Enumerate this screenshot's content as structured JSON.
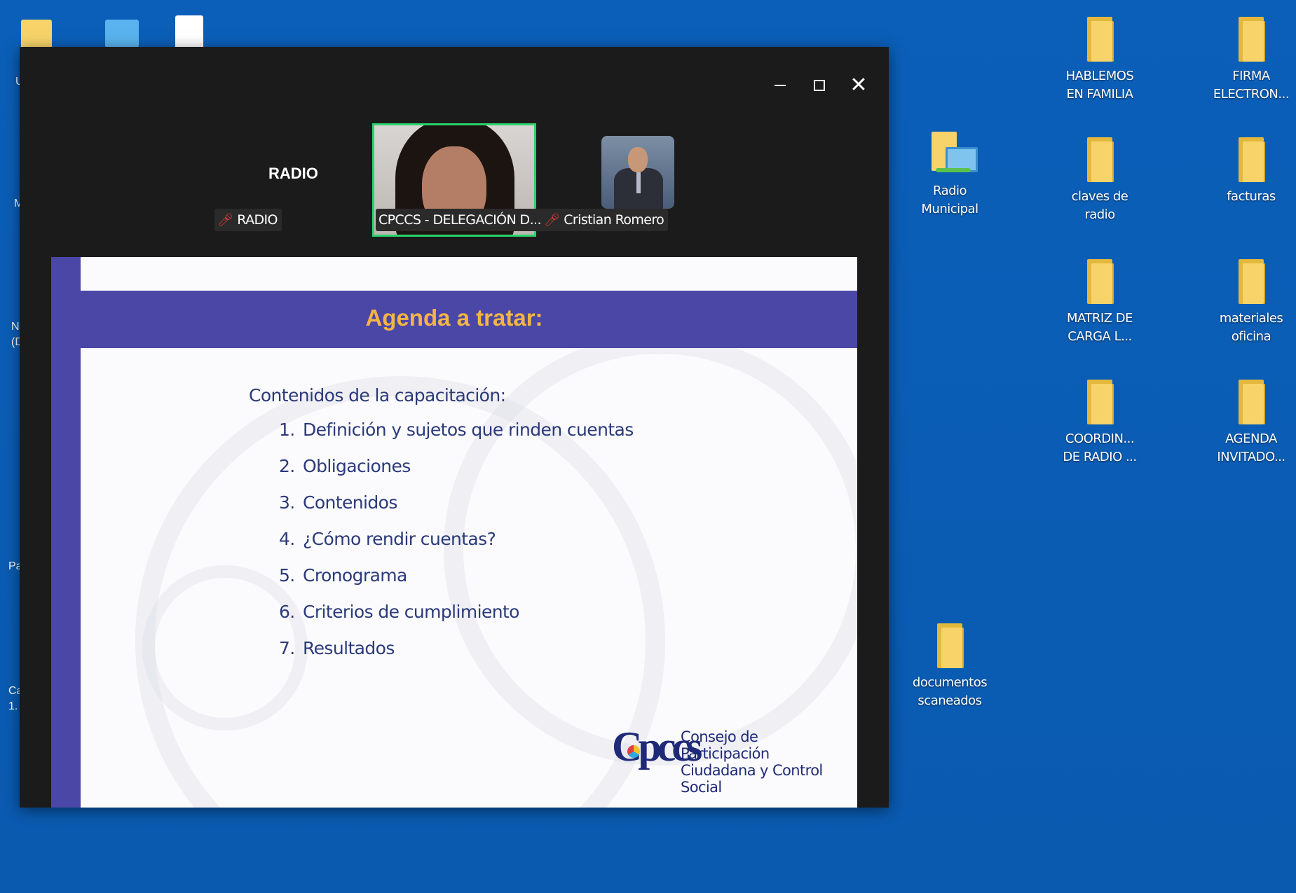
{
  "desktop": {
    "icons": [
      {
        "label": "HABLEMOS\nEN FAMILIA"
      },
      {
        "label": "FIRMA\nELECTRON..."
      },
      {
        "label": "Radio\nMunicipal"
      },
      {
        "label": "claves de\nradio"
      },
      {
        "label": "facturas"
      },
      {
        "label": "MATRIZ DE\nCARGA L..."
      },
      {
        "label": "materiales\noficina"
      },
      {
        "label": "COORDIN...\nDE RADIO ..."
      },
      {
        "label": "AGENDA\nINVITADO..."
      },
      {
        "label": "documentos\nscaneados"
      }
    ],
    "partial_labels": [
      "U",
      "M",
      "N\n(D",
      "Pa",
      "Ca\n1."
    ]
  },
  "window": {
    "participants": {
      "radio_title": "RADIO",
      "radio_tag": "RADIO",
      "speaker_tag": "CPCCS - DELEGACIÓN D...",
      "other_tag": "Cristian Romero"
    },
    "slide": {
      "title": "Agenda a tratar:",
      "intro": "Contenidos de la capacitación:",
      "items": [
        {
          "num": "1.",
          "text": "Definición y sujetos que rinden cuentas"
        },
        {
          "num": "2.",
          "text": "Obligaciones"
        },
        {
          "num": "3.",
          "text": "Contenidos"
        },
        {
          "num": "4.",
          "text": "¿Cómo rendir cuentas?"
        },
        {
          "num": "5.",
          "text": "Cronograma"
        },
        {
          "num": "6.",
          "text": "Criterios de cumplimiento"
        },
        {
          "num": "7.",
          "text": "Resultados"
        }
      ],
      "logo_mark": "Cpccs",
      "logo_line1": "Consejo de Participación",
      "logo_line2": "Ciudadana y Control Social"
    }
  },
  "colors": {
    "desktop_bg": "#0a5cb4",
    "slide_accent": "#4b47a6",
    "title_color": "#f5b445",
    "active_speaker_border": "#29d36b"
  }
}
